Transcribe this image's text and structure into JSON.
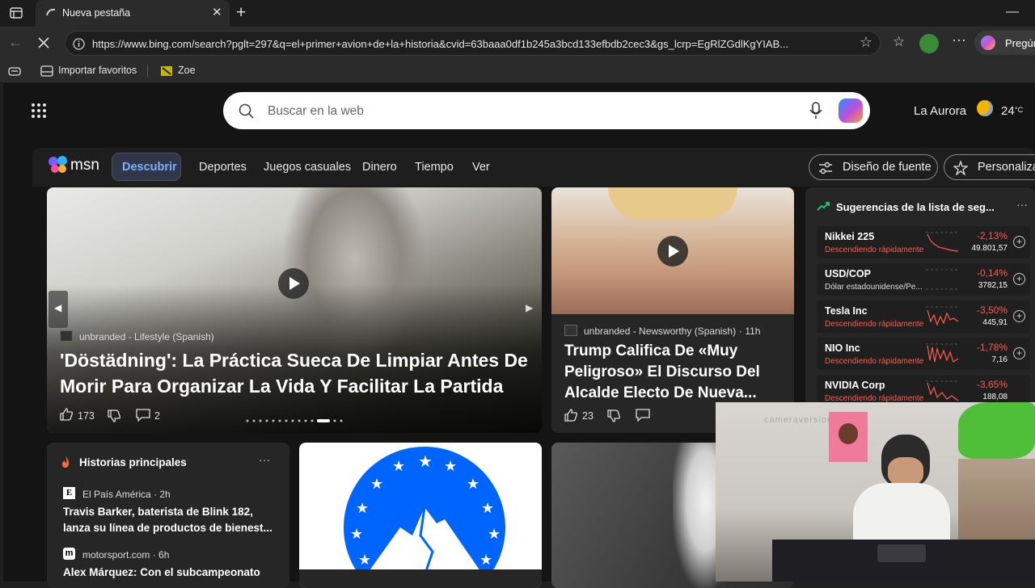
{
  "tab": {
    "title": "Nueva pestaña"
  },
  "address": {
    "url": "https://www.bing.com/search?pglt=297&q=el+primer+avion+de+la+historia&cvid=63baaa0df1b245a3bcd133efbdb2cec3&gs_lcrp=EgRlZGdlKgYIAB..."
  },
  "toolbar": {
    "copilot_label": "Pregún"
  },
  "favorites": {
    "import_label": "Importar favoritos",
    "zoe_label": "Zoe"
  },
  "search": {
    "placeholder": "Buscar en la web"
  },
  "weather": {
    "location": "La Aurora",
    "temp": "24",
    "unit": "°C"
  },
  "msn": {
    "logo": "msn",
    "nav": [
      "Descubrir",
      "Deportes",
      "Juegos casuales",
      "Dinero",
      "Tiempo",
      "Ver"
    ],
    "font_button": "Diseño de fuente",
    "personalize_button": "Personalizar"
  },
  "hero": {
    "source": "unbranded - Lifestyle (Spanish)",
    "headline": "'Döstädning': La Práctica Sueca De Limpiar Antes De Morir Para Organizar La Vida Y Facilitar La Partida",
    "likes": "173",
    "comments": "2"
  },
  "story2": {
    "source": "unbranded - Newsworthy (Spanish)",
    "time": "· 11h",
    "headline": "Trump Califica De «Muy Peligroso» El Discurso Del Alcalde Electo De Nueva...",
    "likes": "23"
  },
  "watchlist": {
    "title": "Sugerencias de la lista de seg...",
    "items": [
      {
        "name": "Nikkei 225",
        "status": "Descendiendo rápidamente",
        "pct": "-2,13%",
        "value": "49.801,57"
      },
      {
        "name": "USD/COP",
        "status": "Dólar estadounidense/Pe...",
        "pct": "-0,14%",
        "value": "3782,15"
      },
      {
        "name": "Tesla Inc",
        "status": "Descendiendo rápidamente",
        "pct": "-3,50%",
        "value": "445,91"
      },
      {
        "name": "NIO Inc",
        "status": "Descendiendo rápidamente",
        "pct": "-1,78%",
        "value": "7,16"
      },
      {
        "name": "NVIDIA Corp",
        "status": "Descendiendo rápidamente",
        "pct": "-3,65%",
        "value": "188,08"
      }
    ]
  },
  "top_stories": {
    "title": "Historias principales",
    "items": [
      {
        "logo": "E",
        "source": "El País América · 2h",
        "headline": "Travis Barker, baterista de Blink 182, lanza su línea de productos de bienest..."
      },
      {
        "logo": "m",
        "source": "motorsport.com · 6h",
        "headline": "Alex Márquez: Con el subcampeonato"
      }
    ]
  },
  "webcam": {
    "watermark": "cameraversion.app"
  },
  "colors": {
    "accent": "#2b7bd9",
    "negative": "#ff5b4f",
    "positive": "#19c37d"
  }
}
